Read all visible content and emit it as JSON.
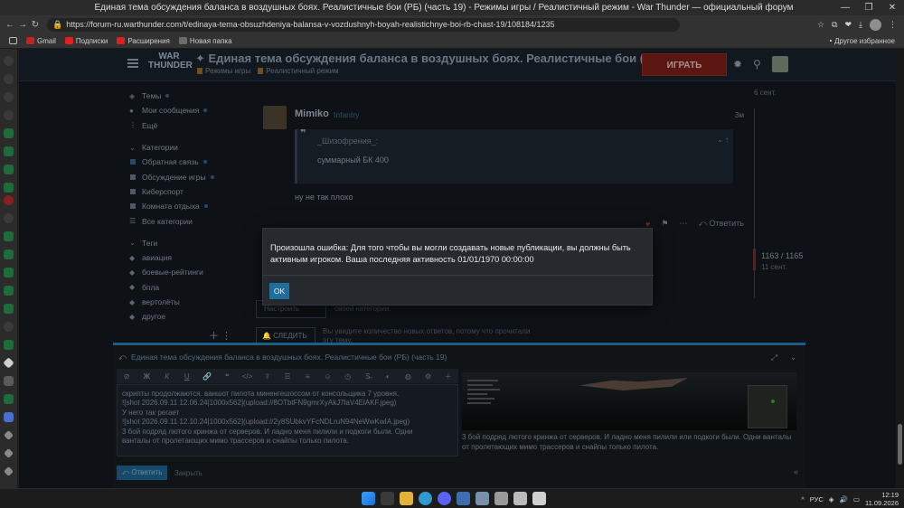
{
  "window": {
    "title": "Единая тема обсуждения баланса в воздушных боях. Реалистичные бои (РБ) (часть 19) - Режимы игры / Реалистичный режим - War Thunder — официальный форум"
  },
  "address": {
    "url": "https://forum-ru.warthunder.com/t/edinaya-tema-obsuzhdeniya-balansa-v-vozdushnyh-boyah-realistichnye-boi-rb-chast-19/108184/1235"
  },
  "bookmarks": {
    "items": [
      "Gmail",
      "Подписки",
      "Расширения",
      "Новая папка"
    ],
    "other": "Другое избранное"
  },
  "site": {
    "logo_line1": "WAR",
    "logo_line2": "THUNDER",
    "topic_title": "Единая тема обсуждения баланса в воздушных боях. Реалистичные бои (РБ...",
    "crumb1": "Режимы игры",
    "crumb2": "Реалистичный режим",
    "play_label": "ИГРАТЬ"
  },
  "sidebar": {
    "top": [
      "Темы",
      "Мои сообщения",
      "Ещё"
    ],
    "categories_header": "Категории",
    "categories": [
      "Обратная связь",
      "Обсуждение игры",
      "Киберспорт",
      "Комната отдыха",
      "Все категории"
    ],
    "tags_header": "Теги",
    "tags": [
      "авиация",
      "боевые-рейтинги",
      "бпла",
      "вертолёты",
      "другое"
    ]
  },
  "post": {
    "author": "Mimiko",
    "role": "Infantry",
    "time": "3м",
    "quote_author": "_Шизофрения_:",
    "quote_text": "суммарный БК 400",
    "body": "ну не так плохо",
    "reply_label": "Ответить"
  },
  "timeline": {
    "top_label": "6 сент.",
    "count": "1163 / 1165",
    "ago": "11 сент."
  },
  "footer_controls": {
    "track_label": "Настроить",
    "track_note": "своей категории.",
    "notify_label": "СЛЕДИТЬ",
    "notify_note": "Вы увидите количество новых ответов, потому что прочитали эту тему."
  },
  "composer": {
    "reply_title": "Единая тема обсуждения баланса в воздушных боях. Реалистичные бои (РБ) (часть 19)",
    "editor_lines": [
      "скрипты продолжаются. ваншот пилота миненгешоссом от консольщика 7 уровня.",
      "![shot 2026.09.11 12.06.24|1000x562](upload://8OTbtFN9gmrXyAkJ7laV4ElAKF.jpeg)",
      "У него так регает",
      "![shot 2026.09.11 12.10.24|1000x562](upload://2y8SUbkvYFcNDLruN94NeWwKwIA.jpeg)",
      "3 бой подряд лютого кринжа от серверов.  И ладно меня пилили и подкоги были. Одни",
      "ванталы от пролетающих мимо трассеров и снайпы только пилота."
    ],
    "preview_text": "3 бой подряд лютого кринжа от серверов. И ладно меня пилили или подкоги были. Одни ванталы от пролетающих мимо трассеров и снайпы только пилота.",
    "submit_label": "Ответить",
    "close_label": "Закрыть"
  },
  "modal": {
    "message": "Произошла ошибка: Для того чтобы вы могли создавать новые публикации, вы должны быть активным игроком. Ваша последняя активность 01/01/1970 00:00:00",
    "ok_label": "OK"
  },
  "taskbar": {
    "lang": "РУС",
    "time": "12:19",
    "date": "11.09.2026"
  },
  "colors": {
    "accent": "#1f6f9c",
    "play": "#5a1712",
    "modal_bg": "#262a2f"
  }
}
